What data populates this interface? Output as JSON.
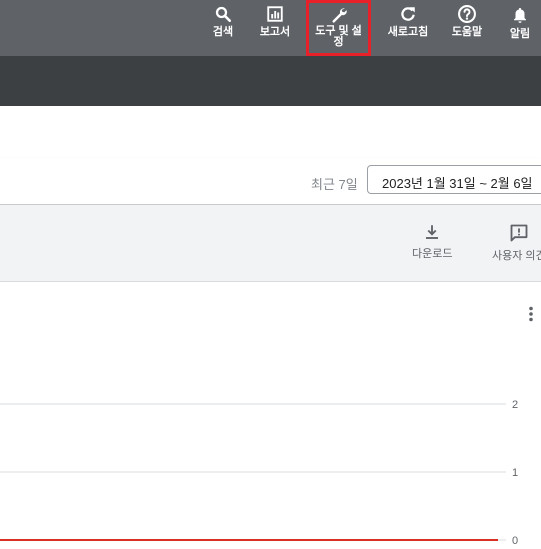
{
  "header": {
    "nav": [
      {
        "id": "search",
        "label": "검색",
        "icon": "search-icon"
      },
      {
        "id": "reports",
        "label": "보고서",
        "icon": "report-chart-icon"
      },
      {
        "id": "tools",
        "label": "도구 및 설정",
        "icon": "wrench-icon"
      },
      {
        "id": "refresh",
        "label": "새로고침",
        "icon": "refresh-icon"
      },
      {
        "id": "help",
        "label": "도움말",
        "icon": "help-circle-icon"
      },
      {
        "id": "notifications",
        "label": "알림",
        "icon": "bell-icon"
      }
    ],
    "highlight_color": "#e8202a"
  },
  "date_range": {
    "prefix": "최근 7일",
    "value": "2023년 1월 31일 ~ 2월 6일"
  },
  "actions": {
    "download": {
      "label": "다운로드",
      "icon": "download-icon"
    },
    "feedback": {
      "label": "사용자 의견",
      "icon": "feedback-icon"
    }
  },
  "chart_data": {
    "type": "line",
    "y_ticks": [
      "2",
      "1",
      "0"
    ],
    "ylim": [
      0,
      2
    ],
    "series": [
      {
        "values": [
          0,
          0,
          0,
          0,
          0,
          0,
          0
        ],
        "color": "#d93025"
      }
    ],
    "grid": true
  }
}
